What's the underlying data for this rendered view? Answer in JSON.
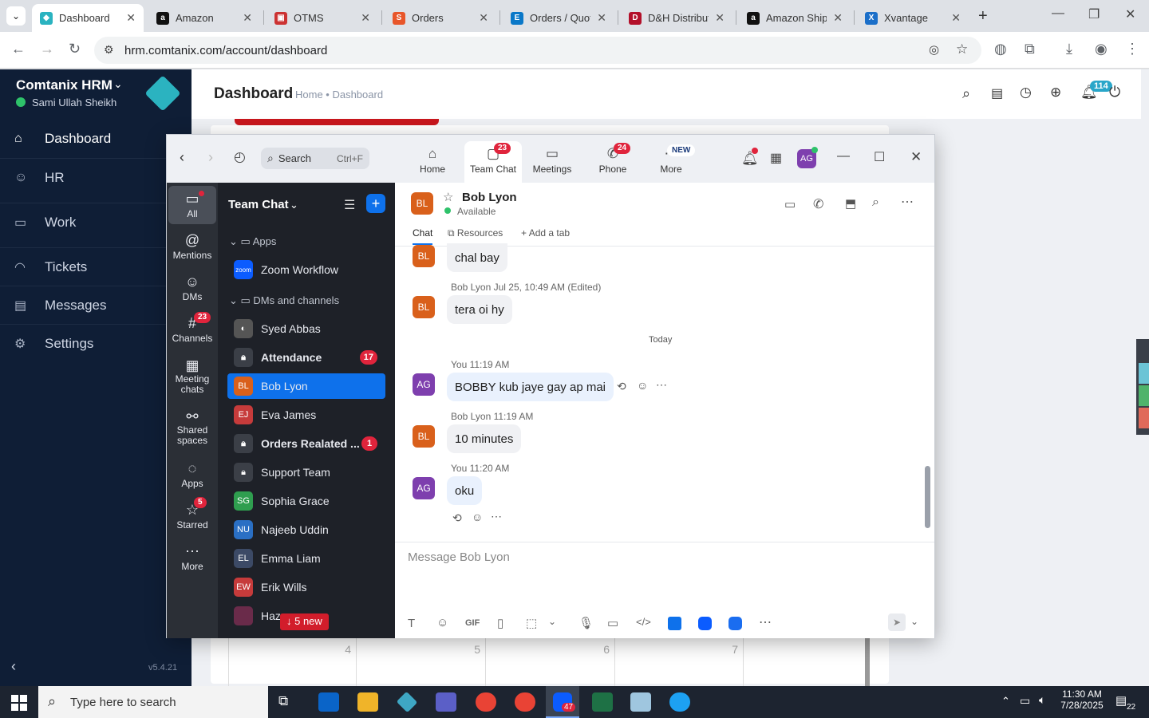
{
  "browser": {
    "tabs": [
      {
        "title": "Dashboard",
        "active": true
      },
      {
        "title": "Amazon"
      },
      {
        "title": "OTMS"
      },
      {
        "title": "Orders"
      },
      {
        "title": "Orders / Quot"
      },
      {
        "title": "D&H Distribut"
      },
      {
        "title": "Amazon Shipp"
      },
      {
        "title": "Xvantage"
      }
    ],
    "url": "hrm.comtanix.com/account/dashboard"
  },
  "hrm": {
    "brand": "Comtanix HRM",
    "user": "Sami Ullah Sheikh",
    "nav": [
      {
        "label": "Dashboard",
        "icon": "home-icon"
      },
      {
        "label": "HR",
        "icon": "people-icon"
      },
      {
        "label": "Work",
        "icon": "briefcase-icon"
      },
      {
        "label": "Tickets",
        "icon": "headset-icon"
      },
      {
        "label": "Messages",
        "icon": "message-icon"
      },
      {
        "label": "Settings",
        "icon": "gear-icon"
      }
    ],
    "version": "v5.4.21",
    "page_title": "Dashboard",
    "breadcrumb": "Home • Dashboard",
    "notif_count": "114",
    "calendar_days": [
      "4",
      "5",
      "6",
      "7"
    ]
  },
  "zoom": {
    "search_placeholder": "Search",
    "search_shortcut": "Ctrl+F",
    "tabs": [
      {
        "label": "Home",
        "icon": "home-icon"
      },
      {
        "label": "Team Chat",
        "icon": "chat-icon",
        "badge": "23"
      },
      {
        "label": "Meetings",
        "icon": "video-icon"
      },
      {
        "label": "Phone",
        "icon": "phone-icon",
        "badge": "24"
      },
      {
        "label": "More",
        "icon": "more-icon",
        "badge": "NEW"
      }
    ],
    "user_initials": "AG",
    "rail": [
      {
        "label": "All",
        "icon": "chat-bubble-icon"
      },
      {
        "label": "Mentions",
        "icon": "at-icon"
      },
      {
        "label": "DMs",
        "icon": "people-icon"
      },
      {
        "label": "Channels",
        "icon": "hash-icon",
        "badge": "23"
      },
      {
        "label": "Meeting chats",
        "icon": "calendar-icon"
      },
      {
        "label": "Shared spaces",
        "icon": "share-icon"
      },
      {
        "label": "Apps",
        "icon": "apps-icon"
      },
      {
        "label": "Starred",
        "icon": "star-icon",
        "badge": "5"
      },
      {
        "label": "More",
        "icon": "more-icon"
      }
    ],
    "list_title": "Team Chat",
    "sections": {
      "apps": "Apps",
      "dms": "DMs and channels"
    },
    "list": [
      {
        "name": "Zoom Workflow",
        "initials": "zoom"
      },
      {
        "name": "Syed Abbas",
        "initials": ""
      },
      {
        "name": "Attendance",
        "initials": "",
        "count": "17",
        "bold": true
      },
      {
        "name": "Bob Lyon",
        "initials": "BL",
        "selected": true
      },
      {
        "name": "Eva James",
        "initials": "EJ"
      },
      {
        "name": "Orders Realated ...",
        "initials": "",
        "count": "1",
        "bold": true
      },
      {
        "name": "Support Team",
        "initials": ""
      },
      {
        "name": "Sophia Grace",
        "initials": "SG"
      },
      {
        "name": "Najeeb Uddin",
        "initials": "NU"
      },
      {
        "name": "Emma Liam",
        "initials": "EL"
      },
      {
        "name": "Erik Wills",
        "initials": "EW"
      },
      {
        "name": "Haza",
        "initials": ""
      }
    ],
    "new_messages": "↓ 5 new",
    "chat": {
      "contact": "Bob Lyon",
      "initials": "BL",
      "status": "Available",
      "tabs": [
        "Chat",
        "Resources",
        "Add a tab"
      ],
      "messages": [
        {
          "from": "BL",
          "text": "chal bay"
        },
        {
          "from": "BL",
          "meta": "Bob Lyon Jul 25, 10:49 AM (Edited)",
          "text": "tera oi hy"
        },
        {
          "divider": "Today"
        },
        {
          "from": "AG",
          "meta": "You 11:19 AM",
          "text": "BOBBY kub jaye gay ap mai"
        },
        {
          "from": "BL",
          "meta": "Bob Lyon 11:19 AM",
          "text": "10 minutes"
        },
        {
          "from": "AG",
          "meta": "You 11:20 AM",
          "text": "oku"
        }
      ],
      "compose_placeholder": "Message Bob Lyon",
      "gif_label": "GIF"
    }
  },
  "taskbar": {
    "search_placeholder": "Type here to search",
    "time": "11:30 AM",
    "date": "7/28/2025",
    "notif_count": "22",
    "zoom_badge": "47"
  },
  "colors": {
    "hrm_sidebar": "#0f1e36",
    "zoom_blue": "#0e71eb",
    "badge_red": "#e0243c"
  }
}
